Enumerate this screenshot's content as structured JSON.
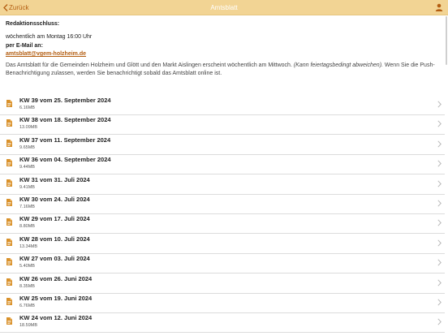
{
  "nav": {
    "back_label": "Zurück",
    "title": "Amtsblatt"
  },
  "info": {
    "deadline_label": "Redaktionsschluss:",
    "deadline_value": "wöchentlich am Montag 16:00 Uhr",
    "email_label": "per E-Mail an:",
    "email": "amtsblatt@vgem-holzheim.de",
    "desc_start": "Das Amtsblatt für die Gemeinden Holzheim und Glött und den Markt Aislingen erscheint wöchentlich am Mittwoch. ",
    "desc_italic": "(Kann feiertagsbedingt abweichen).",
    "desc_end": " Wenn Sie die Push-Benachrichtigung zulassen, werden Sie benachrichtigt sobald das Amtsblatt online ist."
  },
  "issues": [
    {
      "title": "KW 39 vom 25. September 2024",
      "size": "6.16MB"
    },
    {
      "title": "KW 38 vom 18. September 2024",
      "size": "13.09MB"
    },
    {
      "title": "KW 37 vom 11. September 2024",
      "size": "9.65MB"
    },
    {
      "title": "KW 36 vom 04. September 2024",
      "size": "9.44MB"
    },
    {
      "title": "KW 31 vom 31. Juli 2024",
      "size": "9.41MB"
    },
    {
      "title": "KW 30 vom 24. Juli 2024",
      "size": "7.16MB"
    },
    {
      "title": "KW 29 vom 17. Juli 2024",
      "size": "8.80MB"
    },
    {
      "title": "KW 28 vom 10. Juli 2024",
      "size": "13.34MB"
    },
    {
      "title": "KW 27 vom 03. Juli 2024",
      "size": "5.40MB"
    },
    {
      "title": "KW 26 vom 26. Juni 2024",
      "size": "8.35MB"
    },
    {
      "title": "KW 25 vom 19. Juni 2024",
      "size": "6.76MB"
    },
    {
      "title": "KW 24 vom 12. Juni 2024",
      "size": "18.59MB"
    }
  ],
  "colors": {
    "navbar": "#f2d494",
    "accent": "#b35d10",
    "doc_icon": "#d9912a"
  },
  "icons": [
    "back-chevron-icon",
    "user-icon",
    "document-icon",
    "chevron-right-icon"
  ]
}
